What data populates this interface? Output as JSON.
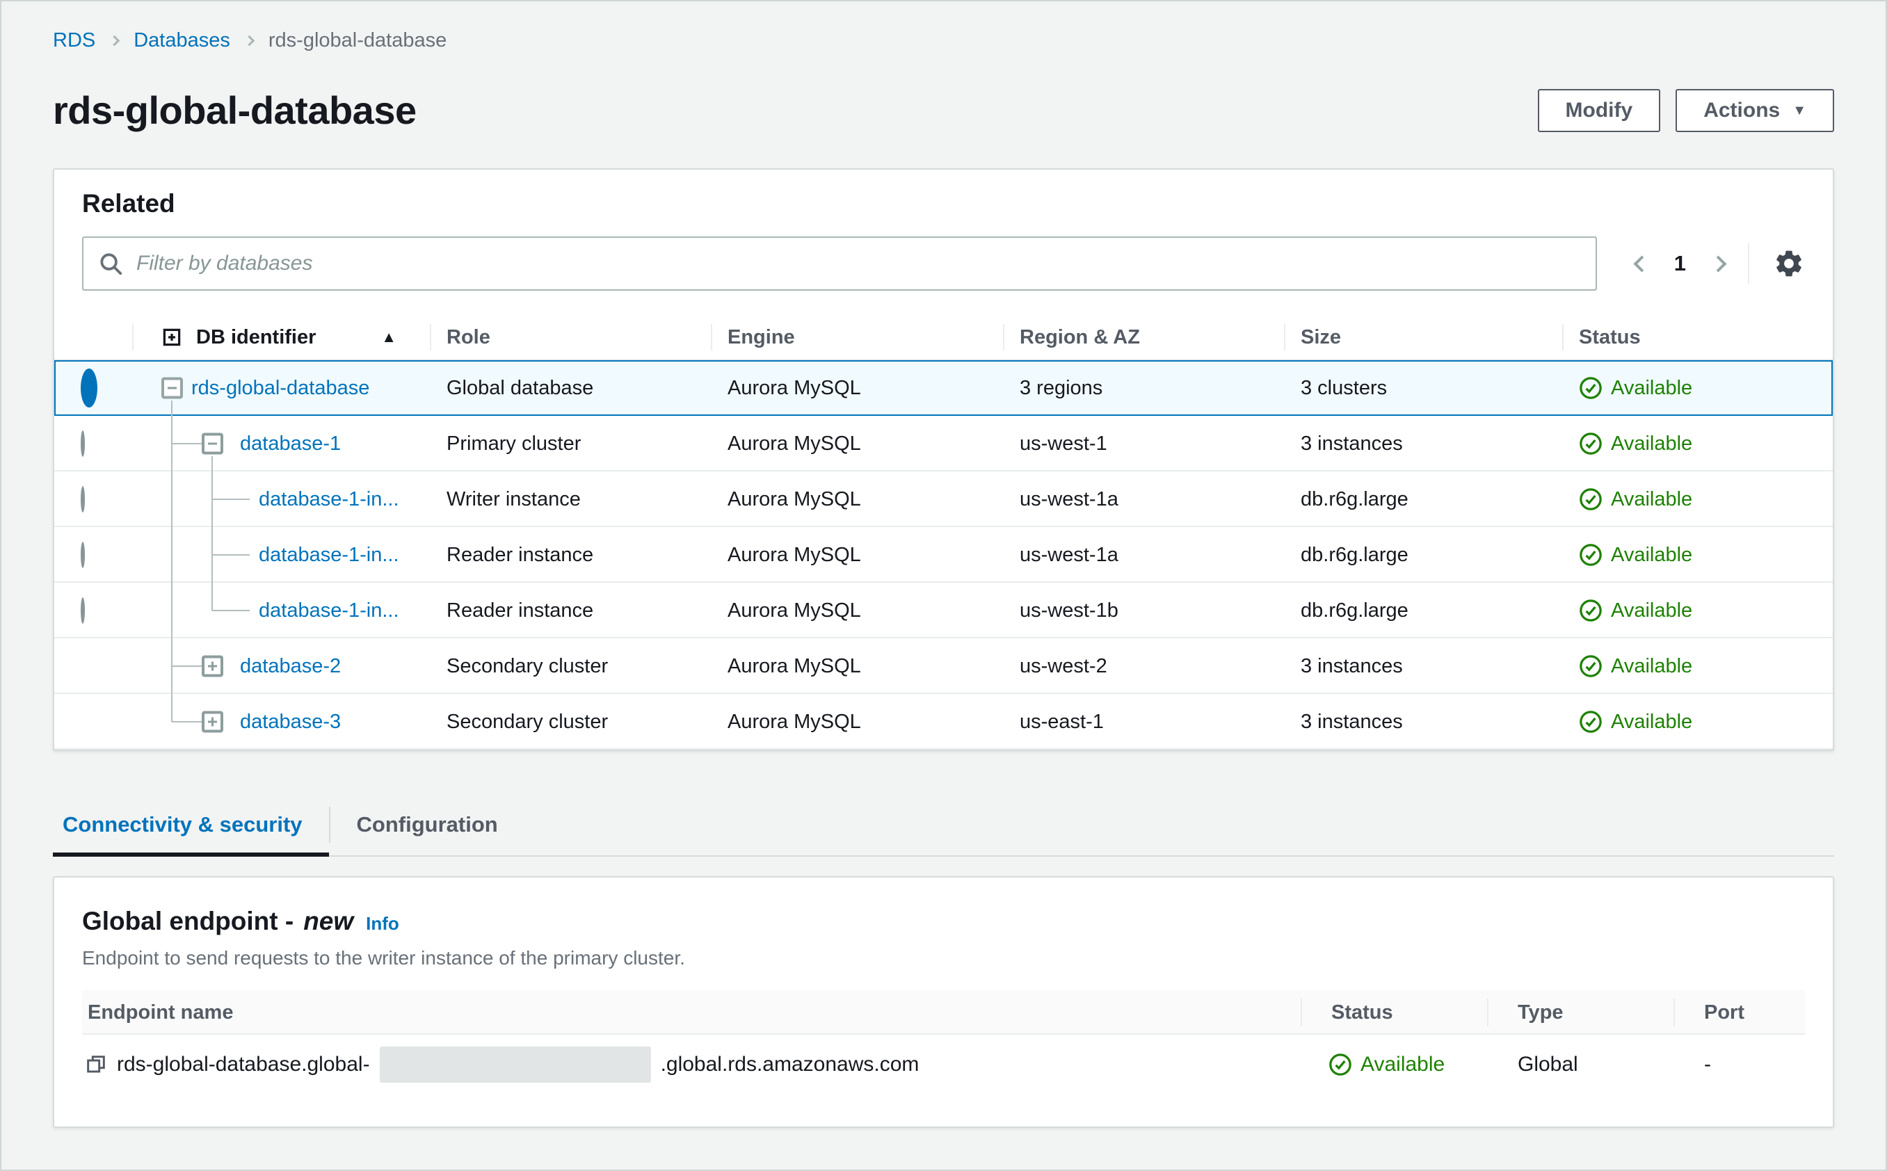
{
  "breadcrumb": {
    "items": [
      "RDS",
      "Databases",
      "rds-global-database"
    ]
  },
  "header": {
    "title": "rds-global-database",
    "modify_label": "Modify",
    "actions_label": "Actions"
  },
  "related": {
    "title": "Related",
    "filter_placeholder": "Filter by databases",
    "page_number": "1",
    "columns": [
      "DB identifier",
      "Role",
      "Engine",
      "Region & AZ",
      "Size",
      "Status"
    ],
    "rows": [
      {
        "id": "rds-global-database",
        "role": "Global database",
        "engine": "Aurora MySQL",
        "region": "3 regions",
        "size": "3 clusters",
        "status": "Available"
      },
      {
        "id": "database-1",
        "role": "Primary cluster",
        "engine": "Aurora MySQL",
        "region": "us-west-1",
        "size": "3 instances",
        "status": "Available"
      },
      {
        "id": "database-1-in...",
        "role": "Writer instance",
        "engine": "Aurora MySQL",
        "region": "us-west-1a",
        "size": "db.r6g.large",
        "status": "Available"
      },
      {
        "id": "database-1-in...",
        "role": "Reader instance",
        "engine": "Aurora MySQL",
        "region": "us-west-1a",
        "size": "db.r6g.large",
        "status": "Available"
      },
      {
        "id": "database-1-in...",
        "role": "Reader instance",
        "engine": "Aurora MySQL",
        "region": "us-west-1b",
        "size": "db.r6g.large",
        "status": "Available"
      },
      {
        "id": "database-2",
        "role": "Secondary cluster",
        "engine": "Aurora MySQL",
        "region": "us-west-2",
        "size": "3 instances",
        "status": "Available"
      },
      {
        "id": "database-3",
        "role": "Secondary cluster",
        "engine": "Aurora MySQL",
        "region": "us-east-1",
        "size": "3 instances",
        "status": "Available"
      }
    ]
  },
  "tabs": {
    "connectivity": "Connectivity & security",
    "configuration": "Configuration"
  },
  "global_endpoint": {
    "title_main": "Global endpoint -",
    "title_new": "new",
    "info_label": "Info",
    "description": "Endpoint to send requests to the writer instance of the primary cluster.",
    "columns": [
      "Endpoint name",
      "Status",
      "Type",
      "Port"
    ],
    "endpoint": {
      "name_prefix": "rds-global-database.global-",
      "name_redacted": true,
      "name_suffix": ".global.rds.amazonaws.com",
      "status": "Available",
      "type": "Global",
      "port": "-"
    }
  },
  "icons": {
    "breadcrumb_sep": "chevron-right",
    "search": "magnifier",
    "pager_prev": "chevron-left",
    "pager_next": "chevron-right",
    "settings": "gear",
    "expand_all": "plus-square",
    "sort_ascending": "filled-triangle-up",
    "actions_caret": "filled-triangle-down",
    "status_ok": "check-circle",
    "copy": "copy-squares",
    "collapse": "minus-box",
    "expand": "plus-box"
  },
  "colors": {
    "link_blue": "#0073bb",
    "status_green": "#1d8102",
    "selected_row_bg": "#f1faff",
    "selected_row_border": "#0073bb",
    "page_bg": "#f2f3f3",
    "panel_border": "#d5dbdb",
    "text_dark": "#16191f",
    "text_gray": "#545b64",
    "tab_active_underline": "#16191f"
  }
}
